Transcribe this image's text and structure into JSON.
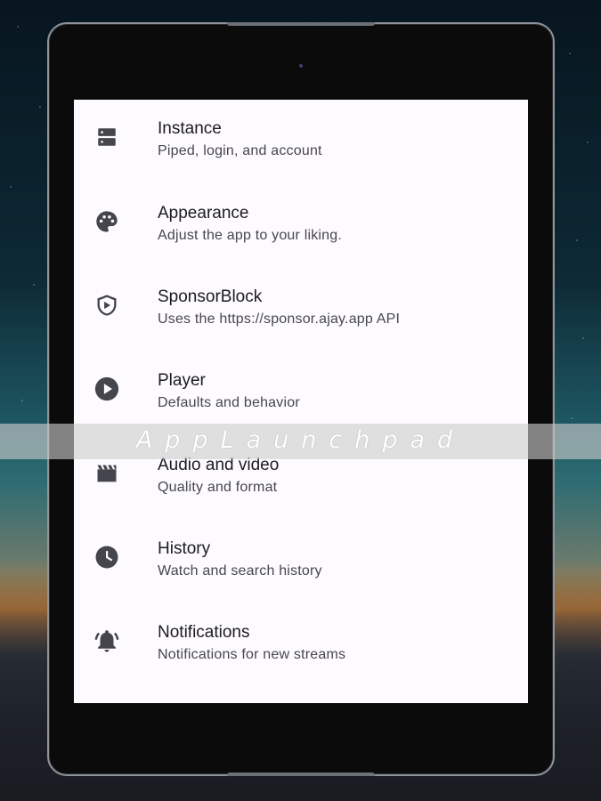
{
  "settings": {
    "items": [
      {
        "title": "Instance",
        "subtitle": "Piped, login, and account",
        "icon": "server-icon"
      },
      {
        "title": "Appearance",
        "subtitle": "Adjust the app to your liking.",
        "icon": "palette-icon"
      },
      {
        "title": "SponsorBlock",
        "subtitle": "Uses the https://sponsor.ajay.app API",
        "icon": "shield-play-icon"
      },
      {
        "title": "Player",
        "subtitle": "Defaults and behavior",
        "icon": "play-circle-icon"
      },
      {
        "title": "Audio and video",
        "subtitle": "Quality and format",
        "icon": "clapperboard-icon"
      },
      {
        "title": "History",
        "subtitle": "Watch and search history",
        "icon": "clock-icon"
      },
      {
        "title": "Notifications",
        "subtitle": "Notifications for new streams",
        "icon": "bell-ringing-icon"
      }
    ]
  },
  "watermark": {
    "text": "AppLaunchpad"
  },
  "colors": {
    "screen_bg": "#fdfbff",
    "icon": "#45454d",
    "title": "#1c1b20",
    "subtitle": "#47464f"
  }
}
